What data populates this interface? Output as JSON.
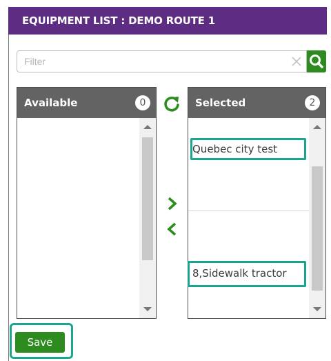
{
  "header": {
    "title": "EQUIPMENT LIST : DEMO ROUTE 1"
  },
  "filter": {
    "placeholder": "Filter",
    "value": ""
  },
  "icons": {
    "clear": "close-icon",
    "search": "search-icon",
    "refresh": "refresh-icon",
    "move_right": "chevron-right-icon",
    "move_left": "chevron-left-icon"
  },
  "available": {
    "title": "Available",
    "count": "0",
    "items": []
  },
  "selected": {
    "title": "Selected",
    "count": "2",
    "items": [
      {
        "label": "Quebec city test"
      },
      {
        "label": "8,Sidewalk tractor"
      }
    ]
  },
  "actions": {
    "save_label": "Save"
  },
  "colors": {
    "header_bg": "#5c2d82",
    "accent_green": "#2e8b1f",
    "panel_header_bg": "#636363",
    "highlight": "#1aa58c"
  }
}
